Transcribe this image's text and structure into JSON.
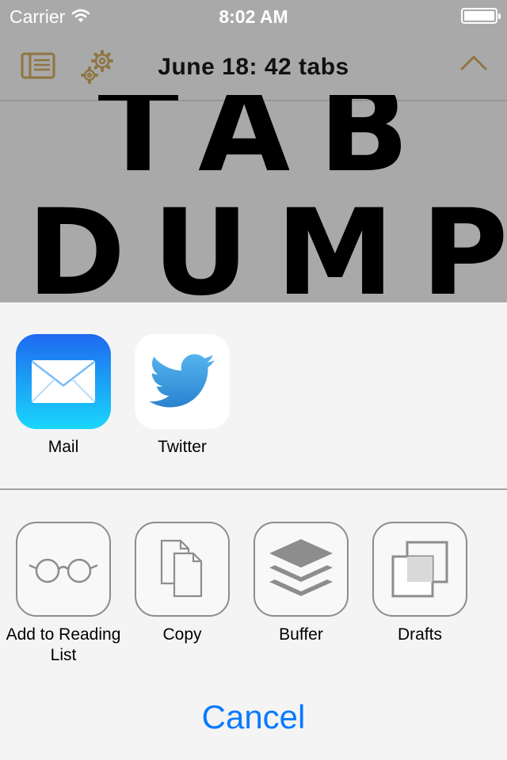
{
  "status_bar": {
    "carrier": "Carrier",
    "time": "8:02 AM",
    "battery_level": 1.0
  },
  "nav": {
    "title": "June 18: 42 tabs",
    "accent_color": "#8f7541",
    "icons": [
      "reader-icon",
      "gear-icon",
      "chevron-up-icon"
    ]
  },
  "article": {
    "hero_line1": "TAB",
    "hero_line2": "DUMP"
  },
  "share_sheet": {
    "apps": [
      {
        "label": "Mail",
        "icon": "mail-icon"
      },
      {
        "label": "Twitter",
        "icon": "twitter-bird-icon"
      }
    ],
    "actions": [
      {
        "label": "Add to Reading List",
        "icon": "glasses-icon"
      },
      {
        "label": "Copy",
        "icon": "copy-icon"
      },
      {
        "label": "Buffer",
        "icon": "buffer-icon"
      },
      {
        "label": "Drafts",
        "icon": "drafts-icon"
      }
    ],
    "cancel_label": "Cancel"
  },
  "colors": {
    "cancel": "#0a7aff",
    "mail_gradient": [
      "#1e69f0",
      "#1ad7fc"
    ],
    "twitter_blue": "#3a9be0"
  }
}
